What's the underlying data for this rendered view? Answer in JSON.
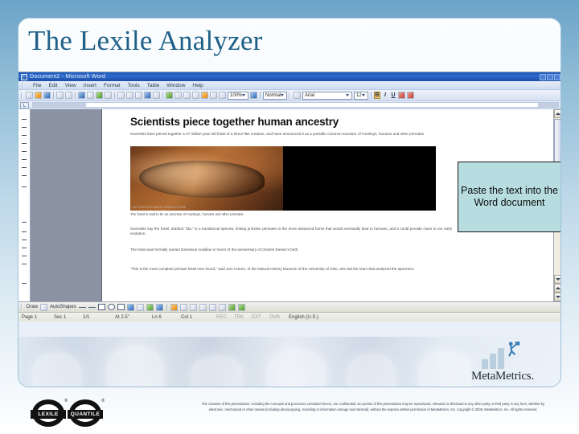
{
  "slide": {
    "title": "The Lexile Analyzer",
    "title_color": "#1f6189",
    "background_top_color": "#6ba3c8",
    "background_bottom_color": "#ffffff"
  },
  "word": {
    "titlebar": {
      "title": "Document2 - Microsoft Word",
      "icon": "word-document-icon",
      "minimize": "_",
      "maximize": "□",
      "close": "×"
    },
    "menu": [
      "File",
      "Edit",
      "View",
      "Insert",
      "Format",
      "Tools",
      "Table",
      "Window",
      "Help"
    ],
    "toolbar": {
      "zoom_value": "100%",
      "style_value": "Normal",
      "font_value": "Arial",
      "font_size_value": "12",
      "bold_label": "B",
      "italic_label": "I",
      "underline_label": "U"
    },
    "drawing_toolbar": {
      "draw_label": "Draw",
      "autoshapes_label": "AutoShapes"
    },
    "status_bar": {
      "page": "Page 1",
      "section": "Sec 1",
      "page_of": "1/1",
      "at": "At 2.5\"",
      "line": "Ln 6",
      "column": "Col 1",
      "rec": "REC",
      "trk": "TRK",
      "ext": "EXT",
      "ovr": "OVR",
      "language": "English (U.S.)"
    },
    "document": {
      "headline": "Scientists piece together human ancestry",
      "paragraph_1": "Scientists have pieced together a 47-million-year-old fossil of a lemur-like creature, and have announced it as a possible common ancestor of monkeys, humans and other primates.",
      "photo_credit": "AP PHOTO/ATLANTIC PRODUCTIONS",
      "caption": "The fossil is said to be an ancestor of monkeys, humans and other primates.",
      "paragraph_2": "Scientists say the fossil, dubbed \"Ida,\" is a transitional species, linking primitive primates to the more advanced forms that would eventually lead to humans, and it could provide clues to our early evolution.",
      "paragraph_3": "The fossil was formally named Darwinius masillae in honor of the anniversary of Charles Darwin's birth.",
      "paragraph_4": "\"This is the most complete primate fossil ever found,\" said Jorn Hurum, of the Natural History Museum of the University of Oslo, who led the team that analyzed the specimen."
    }
  },
  "callout": {
    "text": "Paste the text into the Word document",
    "background_color": "#b7dde1",
    "border_color": "#1a1a1a"
  },
  "branding": {
    "metametrics_name": "MetaMetrics.",
    "seal_1_label": "LEXILE",
    "seal_2_label": "QUANTILE",
    "registered_mark": "®"
  },
  "footer": {
    "notice": "The contents of this presentation, including the concepts and processes contained herein, are confidential. No portion of this presentation may be reproduced, released or disclosed to any other party or third party in any form, whether by electronic, mechanical or other means (including photocopying, recording or information storage and retrieval), without the express written permission of MetaMetrics, Inc. Copyright © 2009, MetaMetrics, Inc. All rights reserved."
  }
}
